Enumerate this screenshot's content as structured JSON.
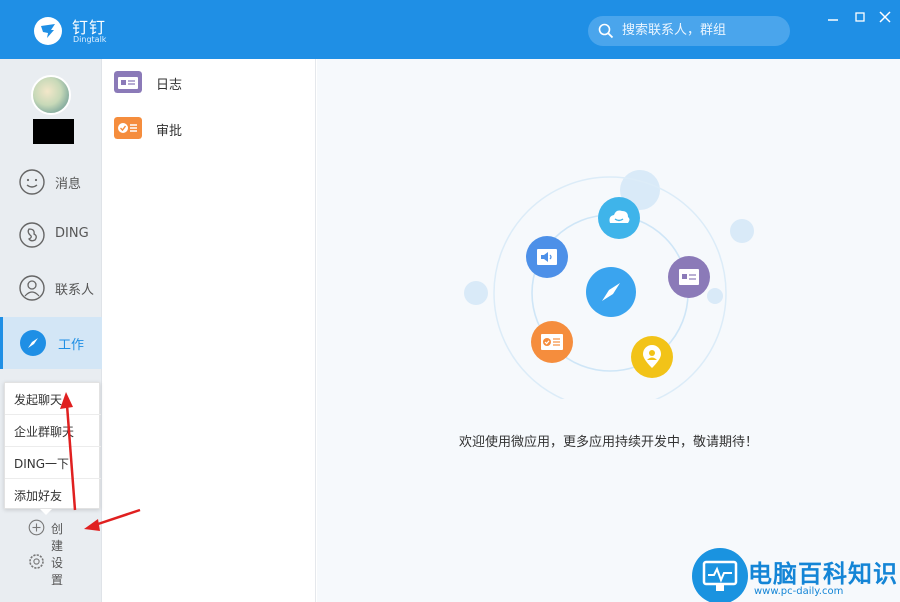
{
  "window": {
    "app_name": "钉钉",
    "app_subtitle": "Dingtalk",
    "search_placeholder": "搜索联系人，群组"
  },
  "sidebar": {
    "items": [
      {
        "label": "消息"
      },
      {
        "label": "DING"
      },
      {
        "label": "联系人"
      },
      {
        "label": "工作"
      }
    ],
    "create_label": "创建",
    "settings_label": "设置"
  },
  "popup_menu": {
    "items": [
      {
        "label": "发起聊天"
      },
      {
        "label": "企业群聊天"
      },
      {
        "label": "DING一下"
      },
      {
        "label": "添加好友"
      }
    ]
  },
  "app_list": {
    "items": [
      {
        "label": "日志",
        "icon": "log-icon",
        "color": "#8b7ab8"
      },
      {
        "label": "审批",
        "icon": "approval-icon",
        "color": "#f58d3d"
      }
    ]
  },
  "main": {
    "welcome_text": "欢迎使用微应用，更多应用持续开发中，敬请期待！"
  },
  "watermark": {
    "title": "电脑百科知识",
    "url": "www.pc-daily.com"
  },
  "colors": {
    "primary": "#1f8fe5",
    "sidebar_bg": "#e9edf1",
    "annotation_arrow": "#e02020"
  }
}
